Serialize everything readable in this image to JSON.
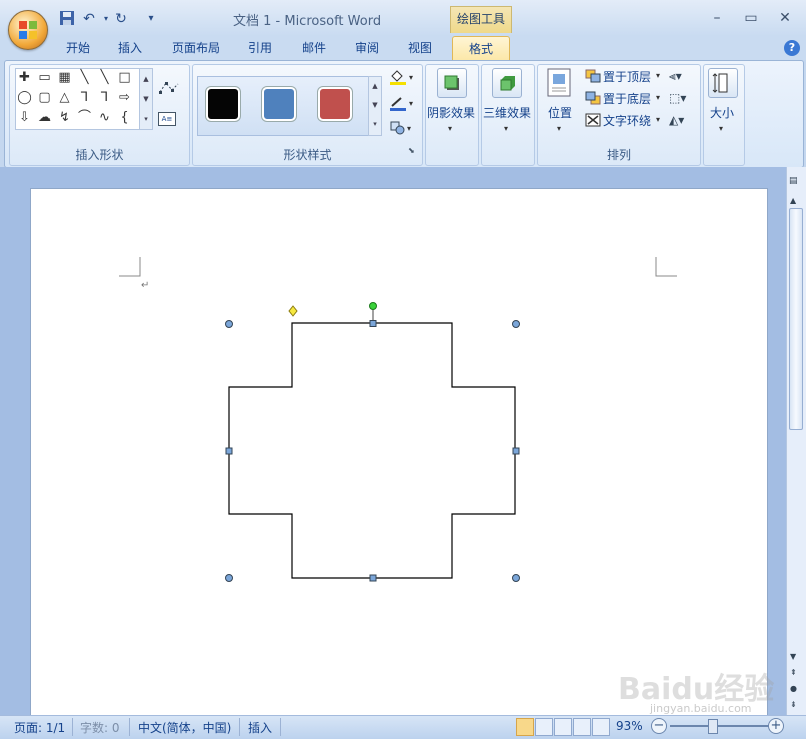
{
  "app": {
    "title": "文档 1 - Microsoft Word",
    "context_tools": "绘图工具"
  },
  "window_controls": {
    "minimize": "–",
    "maximize": "▭",
    "close": "✕"
  },
  "tabs": [
    {
      "label": "开始"
    },
    {
      "label": "插入"
    },
    {
      "label": "页面布局"
    },
    {
      "label": "引用"
    },
    {
      "label": "邮件"
    },
    {
      "label": "审阅"
    },
    {
      "label": "视图"
    },
    {
      "label": "格式",
      "active": true
    }
  ],
  "help_label": "?",
  "ribbon": {
    "insert_shapes": {
      "label": "插入形状",
      "rows": [
        [
          "✚",
          "▭",
          "▦",
          "╲",
          "╲",
          "□"
        ],
        [
          "◯",
          "▢",
          "△",
          "⅂",
          "⅂",
          "⇨"
        ],
        [
          "⇩",
          "☁",
          "↯",
          "⌒",
          "∿",
          "{"
        ]
      ],
      "extra_icons": [
        "edit-points-icon",
        "text-box-icon"
      ]
    },
    "shape_styles": {
      "label": "形状样式",
      "swatches": [
        {
          "name": "black",
          "color": "#050505"
        },
        {
          "name": "blue",
          "color": "#4f81bd"
        },
        {
          "name": "red",
          "color": "#c0504d"
        }
      ]
    },
    "shadow": {
      "label": "阴影效果"
    },
    "three_d": {
      "label": "三维效果"
    },
    "arrange": {
      "label": "排列",
      "position": "位置",
      "bring_front": "置于顶层",
      "send_back": "置于底层",
      "text_wrap": "文字环绕"
    },
    "size": {
      "label": "大小"
    }
  },
  "document": {
    "paragraph_mark": "↵",
    "shape": "cross"
  },
  "status": {
    "page": "页面: 1/1",
    "words": "字数: 0",
    "language": "中文(简体，中国)",
    "mode": "插入",
    "zoom": "93%",
    "zoom_minus": "−",
    "zoom_plus": "+"
  },
  "watermark": {
    "text": "Baidu经验",
    "sub": "jingyan.baidu.com"
  }
}
